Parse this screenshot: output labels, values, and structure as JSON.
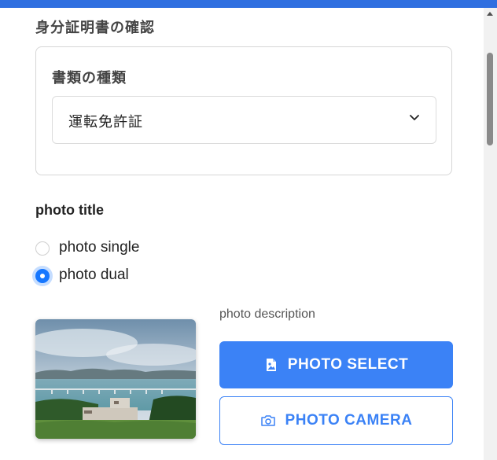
{
  "section_title": "身分証明書の確認",
  "document_card": {
    "label": "書類の種類",
    "select_value": "運転免許証"
  },
  "photo_options": {
    "title": "photo title",
    "options": [
      {
        "label": "photo single",
        "selected": false
      },
      {
        "label": "photo dual",
        "selected": true
      }
    ]
  },
  "photo_panel": {
    "description": "photo description",
    "select_button": "PHOTO SELECT",
    "camera_button": "PHOTO CAMERA"
  },
  "icons": {
    "select_button_icon": "image-file-icon",
    "camera_button_icon": "camera-icon",
    "dropdown_icon": "chevron-down-icon"
  },
  "colors": {
    "accent": "#3b82f6",
    "top_bar": "#2f6fe0",
    "radio_selected": "#1677ff"
  }
}
